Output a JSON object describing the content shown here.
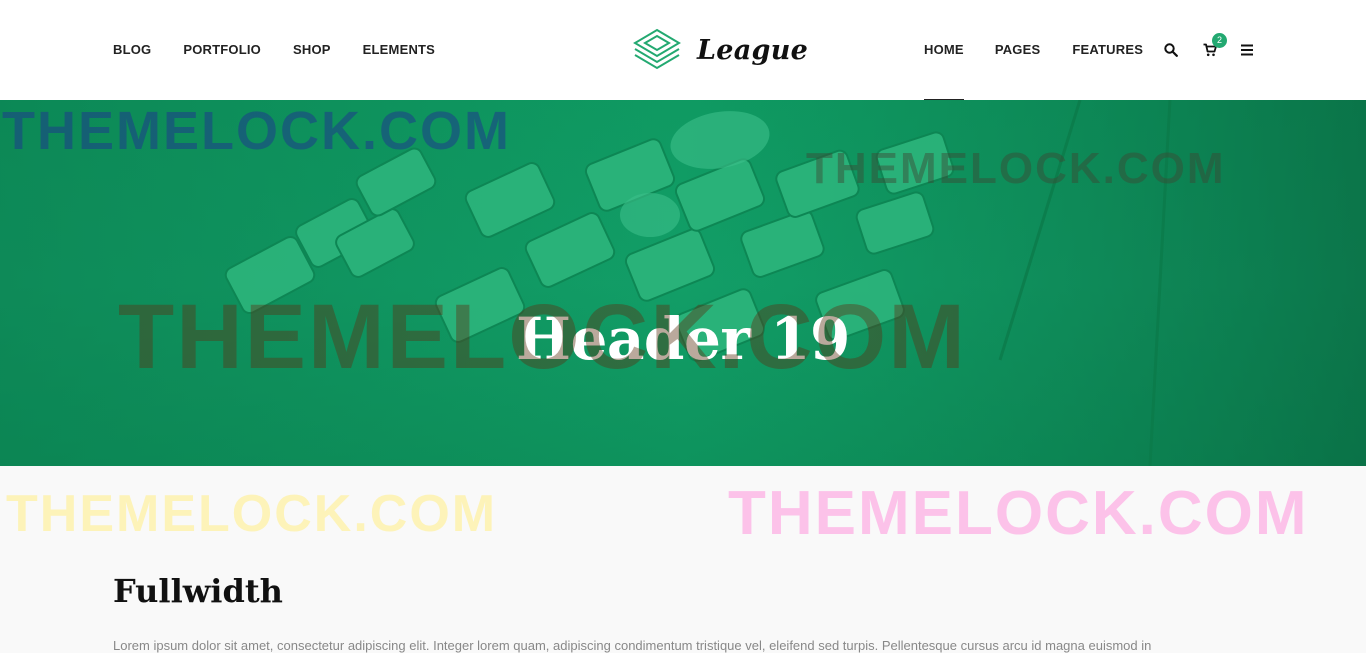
{
  "nav_left": [
    "BLOG",
    "PORTFOLIO",
    "SHOP",
    "ELEMENTS"
  ],
  "logo": {
    "text": "League"
  },
  "nav_right": [
    "HOME",
    "PAGES",
    "FEATURES"
  ],
  "cart": {
    "count": "2"
  },
  "hero": {
    "title": "Header 19"
  },
  "watermark": "THEMELOCK.COM",
  "content": {
    "title": "Fullwidth",
    "text": "Lorem ipsum dolor sit amet, consectetur adipiscing elit. Integer lorem quam, adipiscing condimentum tristique vel, eleifend sed turpis. Pellentesque cursus arcu id magna euismod in"
  },
  "colors": {
    "accent": "#23a971",
    "hero_bg": "#129e67",
    "text_dark": "#222222"
  },
  "icons": {
    "logo": "layers-icon",
    "search": "search-icon",
    "cart": "cart-icon",
    "menu": "hamburger-menu-icon"
  }
}
